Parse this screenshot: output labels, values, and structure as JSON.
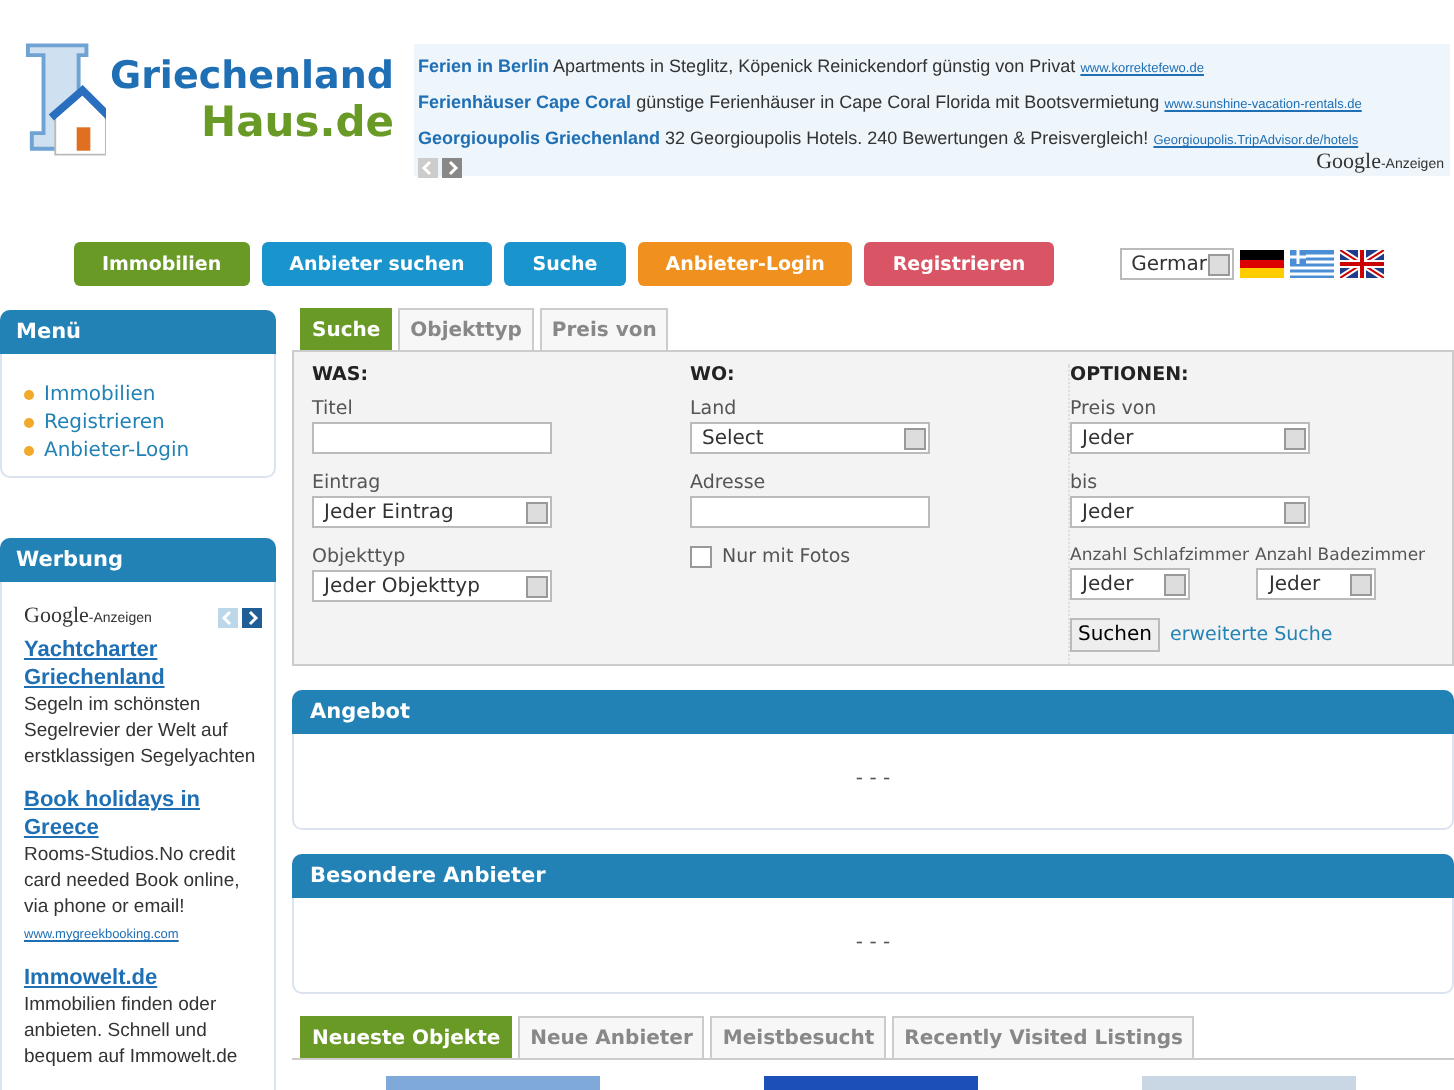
{
  "logo": {
    "line1": "Griechenland",
    "line2": "Haus.de"
  },
  "top_ads": {
    "items": [
      {
        "title": "Ferien in Berlin",
        "text": "Apartments in Steglitz, Köpenick Reinickendorf günstig von Privat",
        "url": "www.korrektefewo.de"
      },
      {
        "title": "Ferienhäuser Cape Coral",
        "text": "günstige Ferienhäuser in Cape Coral Florida mit Bootsvermietung",
        "url": "www.sunshine-vacation-rentals.de"
      },
      {
        "title": "Georgioupolis Griechenland",
        "text": "32 Georgioupolis Hotels. 240 Bewertungen & Preisvergleich!",
        "url": "Georgioupolis.TripAdvisor.de/hotels"
      }
    ],
    "brand": "Google",
    "suffix": "-Anzeigen"
  },
  "nav": [
    {
      "label": "Immobilien",
      "color": "#6a9a26"
    },
    {
      "label": "Anbieter suchen",
      "color": "#1a94cc"
    },
    {
      "label": "Suche",
      "color": "#1a94cc"
    },
    {
      "label": "Anbieter-Login",
      "color": "#f0901e"
    },
    {
      "label": "Registrieren",
      "color": "#d95465"
    }
  ],
  "language": {
    "value": "Germar"
  },
  "sidebar": {
    "menu": {
      "title": "Menü",
      "items": [
        "Immobilien",
        "Registrieren",
        "Anbieter-Login"
      ]
    },
    "werbung": {
      "title": "Werbung",
      "brand": "Google",
      "suffix": "-Anzeigen",
      "ads": [
        {
          "title": "Yachtcharter Griechenland",
          "text": "Segeln im schönsten Segelrevier der Welt auf erstklassigen Segelyachten"
        },
        {
          "title": "Book holidays in Greece",
          "text": "Rooms-Studios.No credit card needed Book online, via phone or email!",
          "url": "www.mygreekbooking.com"
        },
        {
          "title": "Immowelt.de",
          "text": "Immobilien finden oder anbieten. Schnell und bequem auf Immowelt.de"
        }
      ]
    }
  },
  "search": {
    "tabs": [
      {
        "label": "Suche",
        "selected": true
      },
      {
        "label": "Objekttyp",
        "selected": false
      },
      {
        "label": "Preis von",
        "selected": false
      }
    ],
    "columns": [
      {
        "heading": "WAS:",
        "fields": [
          {
            "kind": "input",
            "label": "Titel"
          },
          {
            "kind": "select",
            "label": "Eintrag",
            "value": "Jeder Eintrag"
          },
          {
            "kind": "select",
            "label": "Objekttyp",
            "value": "Jeder Objekttyp"
          }
        ]
      },
      {
        "heading": "WO:",
        "fields": [
          {
            "kind": "select",
            "label": "Land",
            "value": "Select"
          },
          {
            "kind": "input",
            "label": "Adresse"
          },
          {
            "kind": "checkbox",
            "label": "Nur mit Fotos",
            "checked": false
          }
        ]
      },
      {
        "heading": "OPTIONEN:",
        "fields": [
          {
            "kind": "select",
            "label": "Preis von",
            "value": "Jeder"
          },
          {
            "kind": "select",
            "label": "bis",
            "value": "Jeder"
          },
          {
            "kind": "pair",
            "fields": [
              {
                "label": "Anzahl Schlafzimmer",
                "value": "Jeder"
              },
              {
                "label": "Anzahl Badezimmer",
                "value": "Jeder"
              }
            ]
          }
        ]
      }
    ],
    "submit": "Suchen",
    "advanced_link": "erweiterte Suche"
  },
  "panels": [
    {
      "title": "Angebot",
      "body": "- - -"
    },
    {
      "title": "Besondere Anbieter",
      "body": "- - -"
    }
  ],
  "listing_tabs": [
    {
      "label": "Neueste Objekte",
      "selected": true
    },
    {
      "label": "Neue Anbieter",
      "selected": false
    },
    {
      "label": "Meistbesucht",
      "selected": false
    },
    {
      "label": "Recently Visited Listings",
      "selected": false
    }
  ]
}
